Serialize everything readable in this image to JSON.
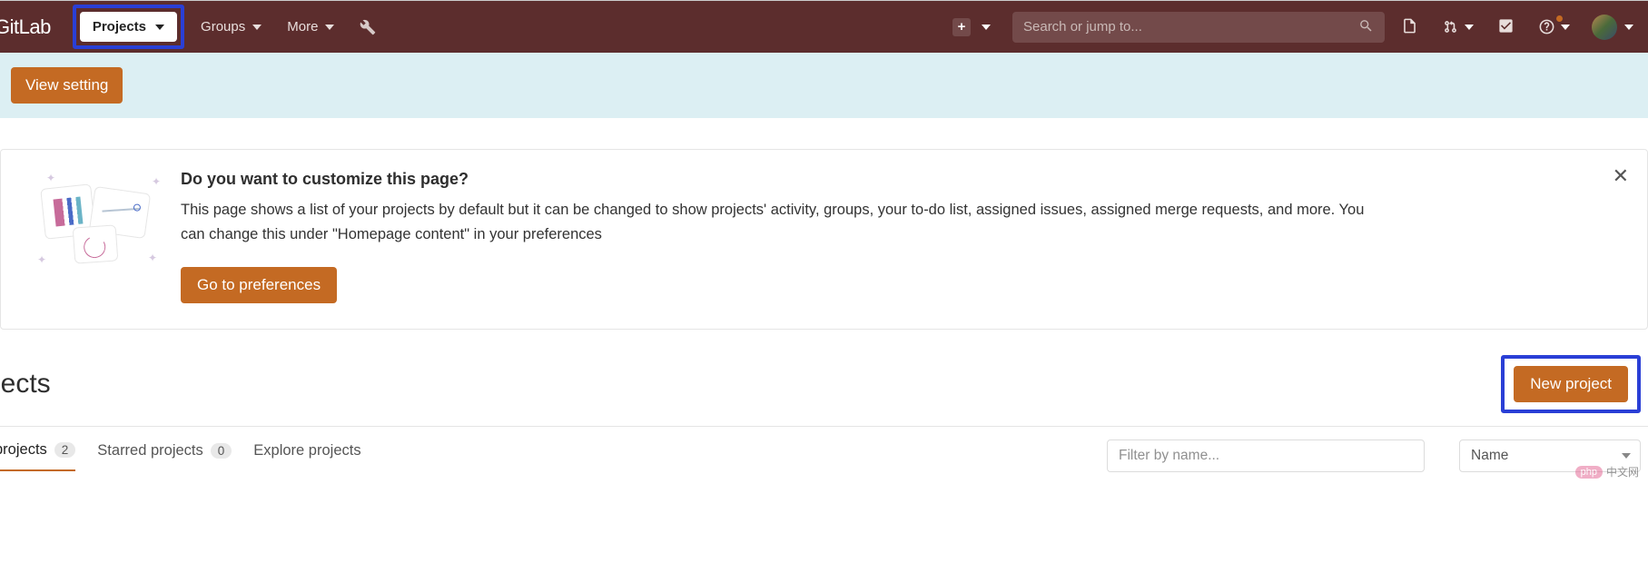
{
  "brand": "GitLab",
  "nav": {
    "projects": "Projects",
    "groups": "Groups",
    "more": "More"
  },
  "search": {
    "placeholder": "Search or jump to..."
  },
  "banner": {
    "view_setting": "View setting"
  },
  "callout": {
    "title": "Do you want to customize this page?",
    "body": "This page shows a list of your projects by default but it can be changed to show projects' activity, groups, your to-do list, assigned issues, assigned merge requests, and more. You can change this under \"Homepage content\" in your preferences",
    "button": "Go to preferences"
  },
  "heading": "jects",
  "new_project": "New project",
  "tabs": {
    "your": {
      "label": "projects",
      "count": "2"
    },
    "starred": {
      "label": "Starred projects",
      "count": "0"
    },
    "explore": {
      "label": "Explore projects"
    }
  },
  "filter": {
    "placeholder": "Filter by name..."
  },
  "sort": {
    "selected": "Name"
  },
  "watermark": {
    "pill": "php",
    "text": "中文网"
  }
}
